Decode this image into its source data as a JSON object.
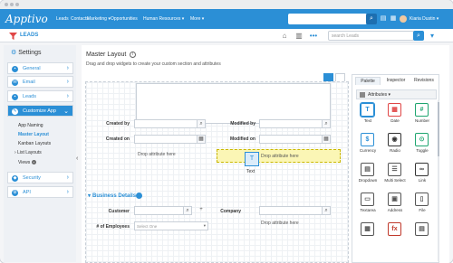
{
  "topnav": {
    "logo": "Apptivo",
    "items": [
      "Leads",
      "Contacts",
      "Marketing ▾",
      "Opportunities",
      "Human Resources ▾",
      "More ▾"
    ],
    "user_name": "Kiaria Dustin ▾",
    "brand_color": "#2b8fd6"
  },
  "subbar": {
    "app_title": "LEADS",
    "search_placeholder": "search Leads"
  },
  "sidebar": {
    "title": "Settings",
    "menus": [
      "General",
      "Email",
      "Leads",
      "Customize App"
    ],
    "customize_items": [
      "App Naming",
      "Master Layout",
      "Kanban Layouts",
      "List Layouts",
      "Views"
    ],
    "bottom_menus": [
      "Security",
      "API"
    ]
  },
  "main": {
    "title": "Master Layout",
    "subtitle": "Drag and drop widgets to create your custom section and attributes",
    "created_by_label": "Created by",
    "modified_by_label": "Modified by",
    "created_on_label": "Created on",
    "modified_on_label": "Modified on",
    "drop_left": "Drop attribute here",
    "drop_right": "Drop attribute here",
    "drag_caption": "Text",
    "section_title": "Business Details",
    "customer_label": "Customer",
    "company_label": "Company",
    "employees_label": "# of Employees",
    "employees_placeholder": "Select One",
    "drop_bottom": "Drop attribute here"
  },
  "palette": {
    "tabs": [
      "Palette",
      "Inspector",
      "Revisions"
    ],
    "attributes_label": "Attributes ▾",
    "widgets": [
      {
        "label": "Text",
        "icon": "text-icon",
        "color": "#2b8fd6"
      },
      {
        "label": "Date",
        "icon": "date-icon",
        "color": "#e04646"
      },
      {
        "label": "Number",
        "icon": "number-icon",
        "color": "#1ea56f"
      },
      {
        "label": "Currency",
        "icon": "currency-icon",
        "color": "#2b8fd6"
      },
      {
        "label": "Radio",
        "icon": "radio-icon",
        "color": "#333333"
      },
      {
        "label": "Toggle",
        "icon": "toggle-icon",
        "color": "#1ea56f"
      },
      {
        "label": "Dropdown",
        "icon": "dropdown-icon",
        "color": "#555555"
      },
      {
        "label": "Multi Select",
        "icon": "multi-select-icon",
        "color": "#555555"
      },
      {
        "label": "Link",
        "icon": "link-icon",
        "color": "#333333"
      },
      {
        "label": "Textarea",
        "icon": "textarea-icon",
        "color": "#555555"
      },
      {
        "label": "Address",
        "icon": "address-icon",
        "color": "#555555"
      },
      {
        "label": "File",
        "icon": "file-icon",
        "color": "#555555"
      },
      {
        "label": "",
        "icon": "table-icon",
        "color": "#555555"
      },
      {
        "label": "",
        "icon": "formula-icon",
        "color": "#c0392b"
      },
      {
        "label": "",
        "icon": "reference-icon",
        "color": "#555555"
      }
    ]
  }
}
